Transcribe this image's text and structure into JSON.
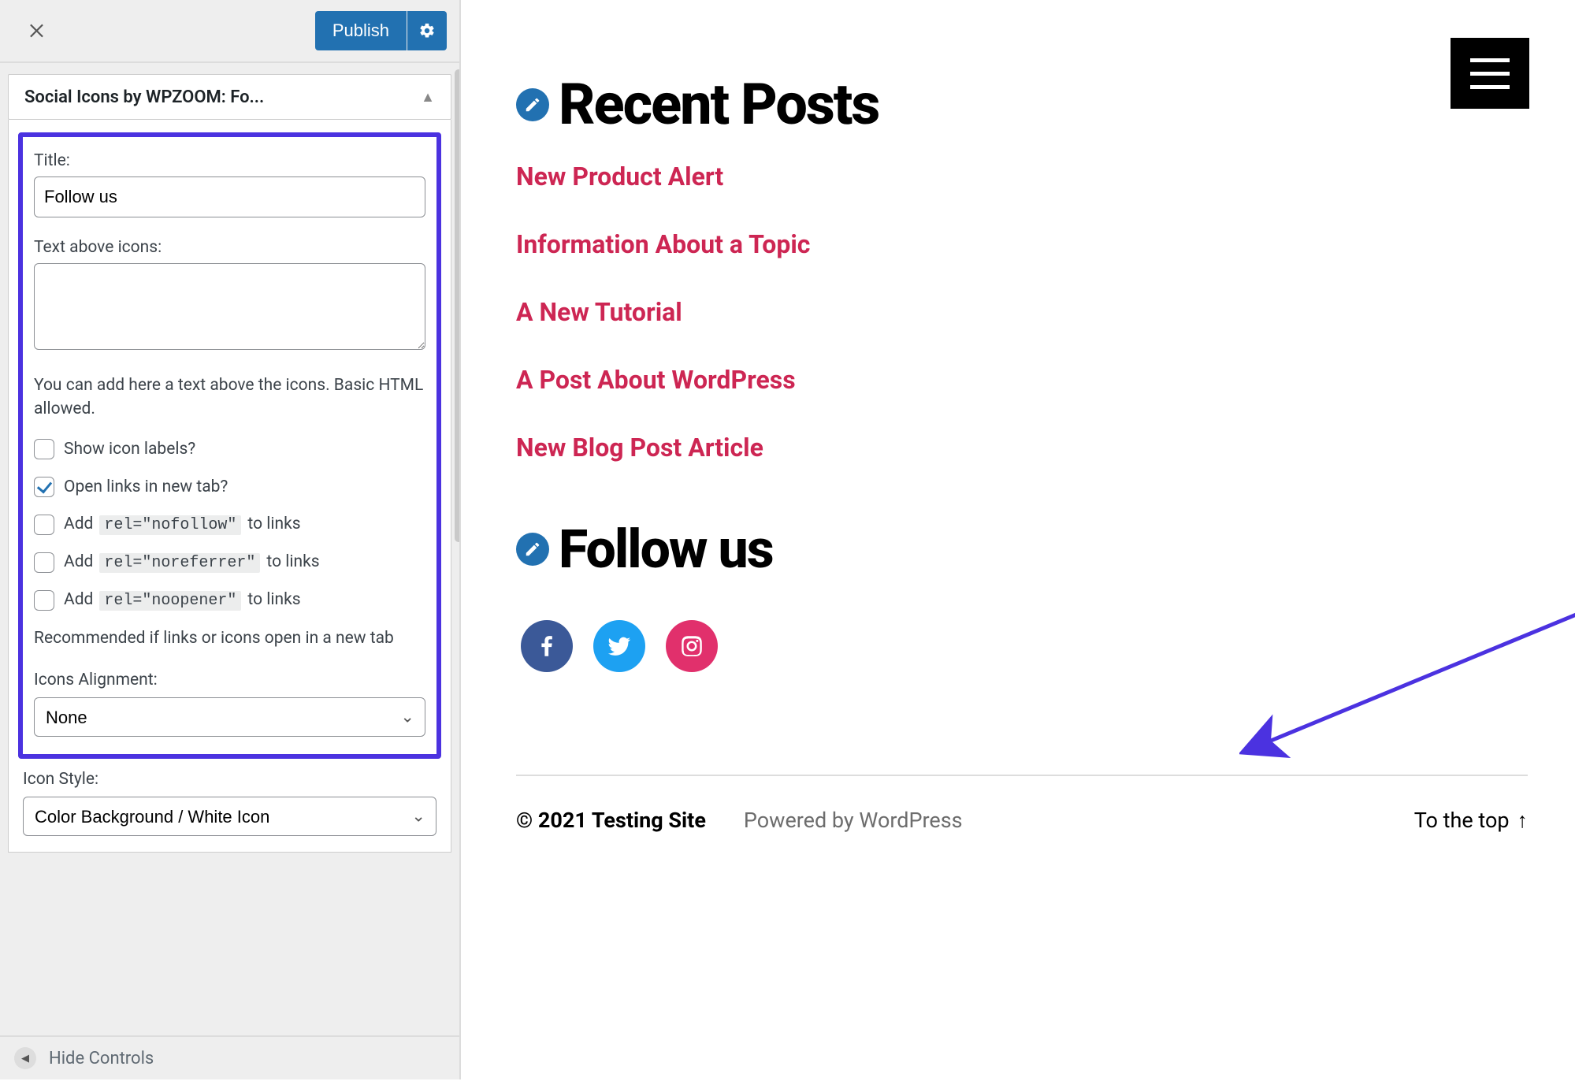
{
  "sidebar": {
    "publish_label": "Publish",
    "widget_title": "Social Icons by WPZOOM: Fo...",
    "fields": {
      "title_label": "Title:",
      "title_value": "Follow us",
      "text_above_label": "Text above icons:",
      "text_above_value": "",
      "helper": "You can add here a text above the icons. Basic HTML allowed.",
      "show_labels": "Show icon labels?",
      "open_new_tab": "Open links in new tab?",
      "add_prefix": "Add",
      "add_suffix": "to links",
      "nofollow_code": "rel=\"nofollow\"",
      "noreferrer_code": "rel=\"noreferrer\"",
      "noopener_code": "rel=\"noopener\"",
      "recommended": "Recommended if links or icons open in a new tab",
      "alignment_label": "Icons Alignment:",
      "alignment_value": "None",
      "icon_style_label": "Icon Style:",
      "icon_style_value": "Color Background / White Icon"
    },
    "hide_controls_label": "Hide Controls"
  },
  "preview": {
    "recent_heading": "Recent Posts",
    "posts": [
      "New Product Alert",
      "Information About a Topic",
      "A New Tutorial",
      "A Post About WordPress",
      "New Blog Post Article"
    ],
    "follow_heading": "Follow us",
    "footer_copy": "© 2021 Testing Site",
    "footer_powered": "Powered by WordPress",
    "to_top": "To the top",
    "to_top_arrow": "↑"
  },
  "colors": {
    "accent_link": "#cd2653",
    "highlight_border": "#4b32e0",
    "wp_blue": "#2271b1"
  }
}
